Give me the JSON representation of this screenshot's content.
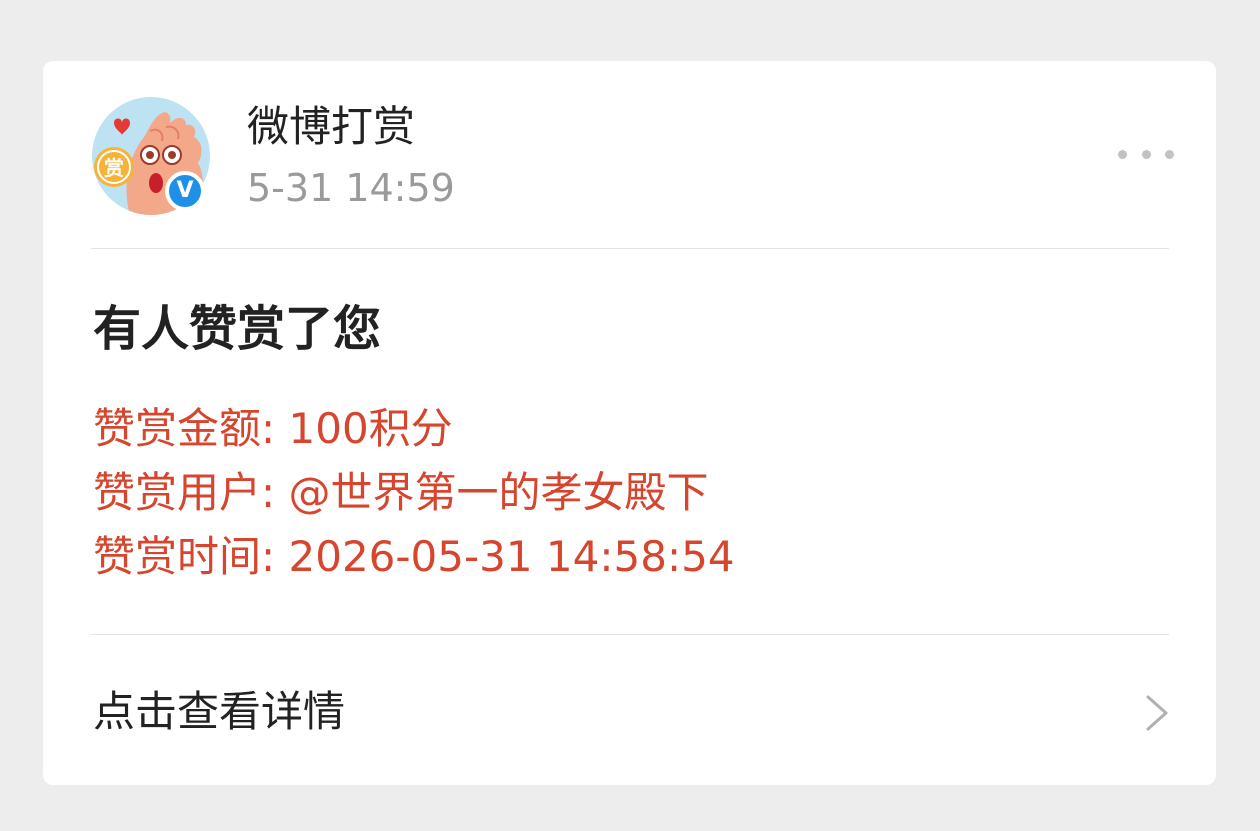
{
  "notification": {
    "account_name": "微博打赏",
    "post_time": "5-31 14:59",
    "avatar_icon": "reward-mascot-avatar",
    "avatar_badge_text": "赏",
    "verified_badge": "V",
    "title": "有人赞赏了您",
    "details": {
      "amount": "赞赏金额: 100积分",
      "user": "赞赏用户: @世界第一的孝女殿下",
      "time": "赞赏时间: 2026-05-31 14:58:54"
    },
    "action_label": "点击查看详情",
    "accent_color": "#d6452e",
    "verified_color": "#1e90e8"
  }
}
